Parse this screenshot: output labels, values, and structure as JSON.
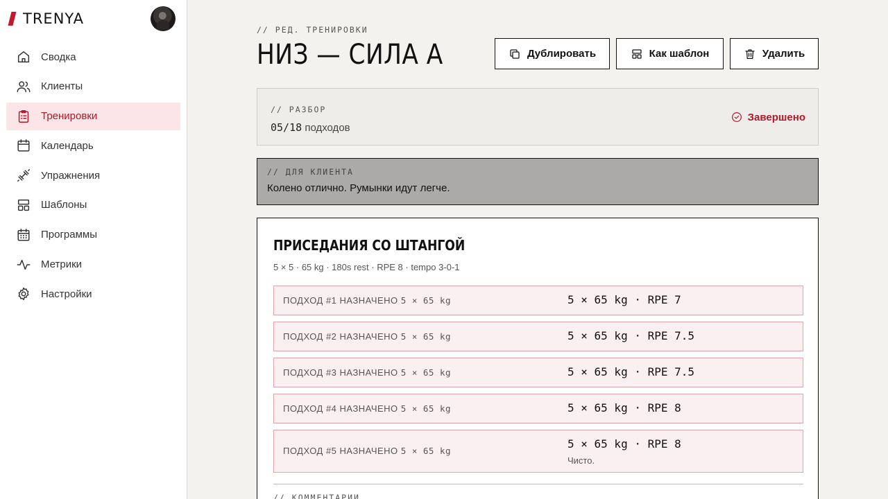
{
  "brand": {
    "name": "TRENYA"
  },
  "nav": [
    {
      "label": "Сводка",
      "icon": "home-icon"
    },
    {
      "label": "Клиенты",
      "icon": "users-icon"
    },
    {
      "label": "Тренировки",
      "icon": "clipboard-icon",
      "active": true
    },
    {
      "label": "Календарь",
      "icon": "calendar-icon"
    },
    {
      "label": "Упражнения",
      "icon": "dumbbell-icon"
    },
    {
      "label": "Шаблоны",
      "icon": "layout-icon"
    },
    {
      "label": "Программы",
      "icon": "calendar-grid-icon"
    },
    {
      "label": "Метрики",
      "icon": "activity-icon"
    },
    {
      "label": "Настройки",
      "icon": "gear-icon"
    }
  ],
  "page": {
    "eyebrow": "// РЕД. ТРЕНИРОВКИ",
    "title": "НИЗ — СИЛА А"
  },
  "actions": {
    "duplicate": "Дублировать",
    "template": "Как шаблон",
    "delete": "Удалить"
  },
  "summary": {
    "eyebrow": "// РАЗБОР",
    "sets_done": "05/18",
    "sets_word": "подходов",
    "status": "Завершено"
  },
  "client_note": {
    "eyebrow": "// ДЛЯ КЛИЕНТА",
    "text": "Колено отлично. Румынки идут легче."
  },
  "exercise": {
    "title": "ПРИСЕДАНИЯ СО ШТАНГОЙ",
    "subtitle": "5 × 5 · 65 kg · 180s rest · RPE 8 · tempo 3-0-1",
    "sets": [
      {
        "label": "ПОДХОД #1 НАЗНАЧЕНО",
        "planned": "5 × 65 kg",
        "result": "5 × 65 kg · RPE 7",
        "note": ""
      },
      {
        "label": "ПОДХОД #2 НАЗНАЧЕНО",
        "planned": "5 × 65 kg",
        "result": "5 × 65 kg · RPE 7.5",
        "note": ""
      },
      {
        "label": "ПОДХОД #3 НАЗНАЧЕНО",
        "planned": "5 × 65 kg",
        "result": "5 × 65 kg · RPE 7.5",
        "note": ""
      },
      {
        "label": "ПОДХОД #4 НАЗНАЧЕНО",
        "planned": "5 × 65 kg",
        "result": "5 × 65 kg · RPE 8",
        "note": ""
      },
      {
        "label": "ПОДХОД #5 НАЗНАЧЕНО",
        "planned": "5 × 65 kg",
        "result": "5 × 65 kg · RPE 8",
        "note": "Чисто."
      }
    ],
    "comments_eyebrow": "// КОММЕНТАРИИ"
  },
  "colors": {
    "accent": "#b3182a",
    "active_bg": "#fbe5e7",
    "set_border": "#e0a5ab",
    "set_bg": "#fbf0f1"
  }
}
